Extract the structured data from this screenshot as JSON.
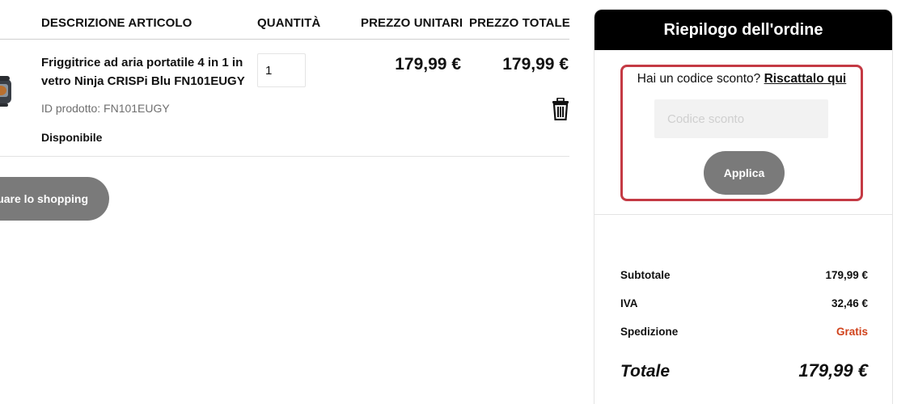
{
  "cart": {
    "headers": {
      "description": "DESCRIZIONE ARTICOLO",
      "quantity": "QUANTITÀ",
      "unit_price": "PREZZO UNITARI",
      "total_price": "PREZZO TOTALE"
    },
    "item": {
      "name": "Friggitrice ad aria portatile 4 in 1 in vetro Ninja CRISPi Blu FN101EUGY",
      "product_id": "ID prodotto: FN101EUGY",
      "availability": "Disponibile",
      "quantity": "1",
      "unit_price": "179,99 €",
      "total_price": "179,99 €"
    },
    "continue_shopping_label": "uare lo shopping"
  },
  "summary": {
    "title": "Riepilogo dell'ordine",
    "coupon_prompt": "Hai un codice sconto?",
    "coupon_link": "Riscattalo qui",
    "coupon_placeholder": "Codice sconto",
    "apply_label": "Applica",
    "subtotal_label": "Subtotale",
    "subtotal_value": "179,99 €",
    "vat_label": "IVA",
    "vat_value": "32,46 €",
    "shipping_label": "Spedizione",
    "shipping_value": "Gratis",
    "total_label": "Totale",
    "total_value": "179,99 €"
  },
  "colors": {
    "highlight_border": "#c43a44",
    "button_gray": "#7a7a7a",
    "free_shipping": "#d0421b",
    "header_black": "#000000"
  },
  "icons": {
    "trash": "trash-icon",
    "product_thumbnail": "air-fryer-thumbnail"
  }
}
